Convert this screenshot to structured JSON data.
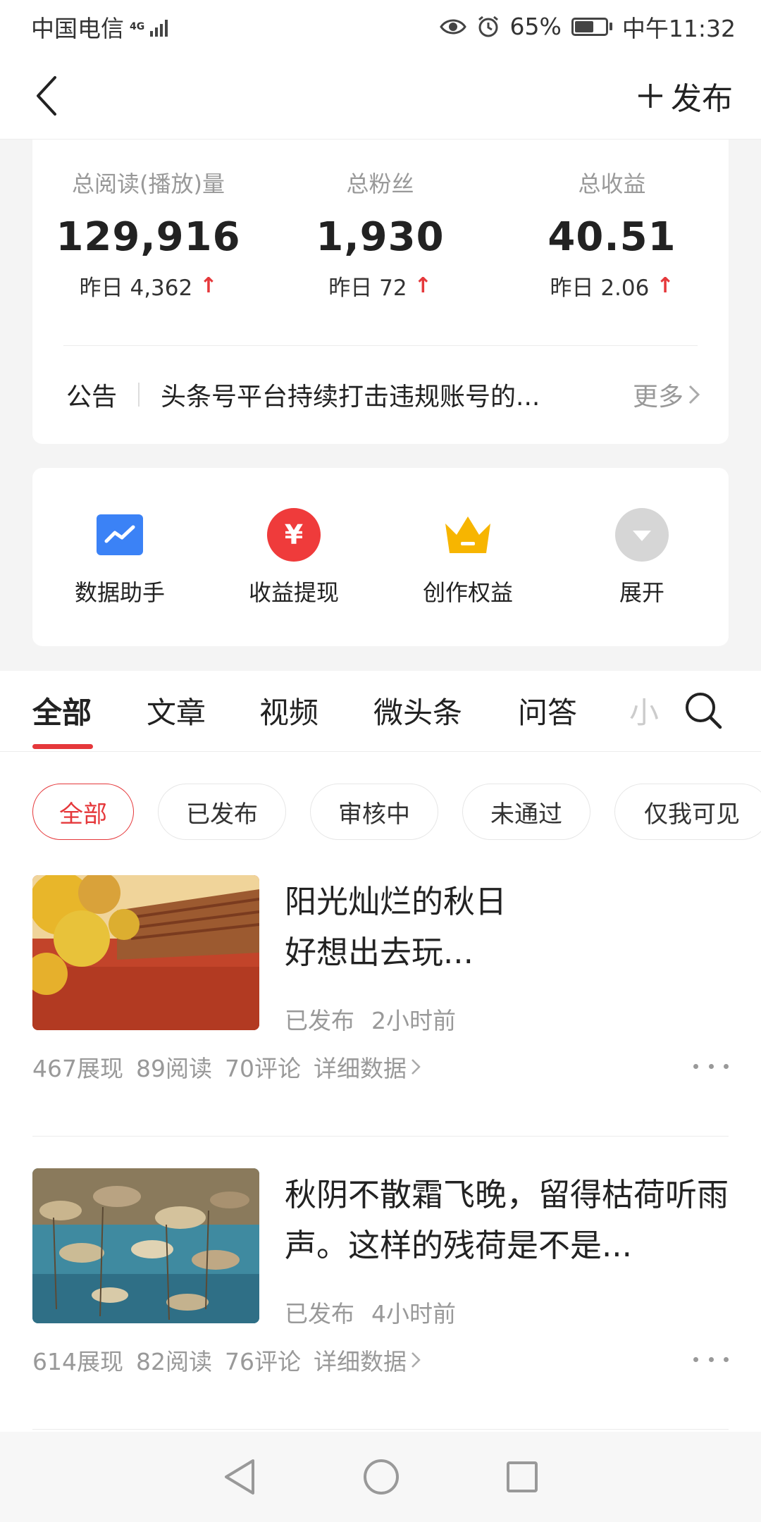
{
  "status_bar": {
    "carrier": "中国电信",
    "network": "4G",
    "battery": "65%",
    "time": "中午11:32"
  },
  "nav": {
    "publish_label": "发布"
  },
  "stats": {
    "items": [
      {
        "label": "总阅读(播放)量",
        "value": "129,916",
        "yesterday": "昨日 4,362"
      },
      {
        "label": "总粉丝",
        "value": "1,930",
        "yesterday": "昨日 72"
      },
      {
        "label": "总收益",
        "value": "40.51",
        "yesterday": "昨日 2.06"
      }
    ],
    "notice": {
      "title": "公告",
      "text": "头条号平台持续打击违规账号的...",
      "more": "更多"
    }
  },
  "tools": {
    "items": [
      {
        "label": "数据助手",
        "icon": "chart-icon",
        "color": "#3b82f6"
      },
      {
        "label": "收益提现",
        "icon": "yuan-icon",
        "color": "#ef3b3b"
      },
      {
        "label": "创作权益",
        "icon": "crown-icon",
        "color": "#f7b500"
      },
      {
        "label": "展开",
        "icon": "expand-icon",
        "color": "#d6d6d6"
      }
    ]
  },
  "tabs": {
    "items": [
      "全部",
      "文章",
      "视频",
      "微头条",
      "问答",
      "小"
    ],
    "active": "全部"
  },
  "filters": {
    "items": [
      "全部",
      "已发布",
      "审核中",
      "未通过",
      "仅我可见"
    ],
    "active": "全部"
  },
  "articles": [
    {
      "title": "阳光灿烂的秋日\n好想出去玩...",
      "status": "已发布",
      "time": "2小时前",
      "views": "467展现",
      "reads": "89阅读",
      "comments": "70评论",
      "detail": "详细数据",
      "thumb_colors": [
        "#e8b62a",
        "#c2442a",
        "#d9a23a"
      ]
    },
    {
      "title": "秋阴不散霜飞晚，留得枯荷听雨声。这样的残荷是不是...",
      "status": "已发布",
      "time": "4小时前",
      "views": "614展现",
      "reads": "82阅读",
      "comments": "76评论",
      "detail": "详细数据",
      "thumb_colors": [
        "#2f6f86",
        "#b9a382",
        "#4f97aa"
      ]
    }
  ],
  "accent_color": "#e5383b"
}
